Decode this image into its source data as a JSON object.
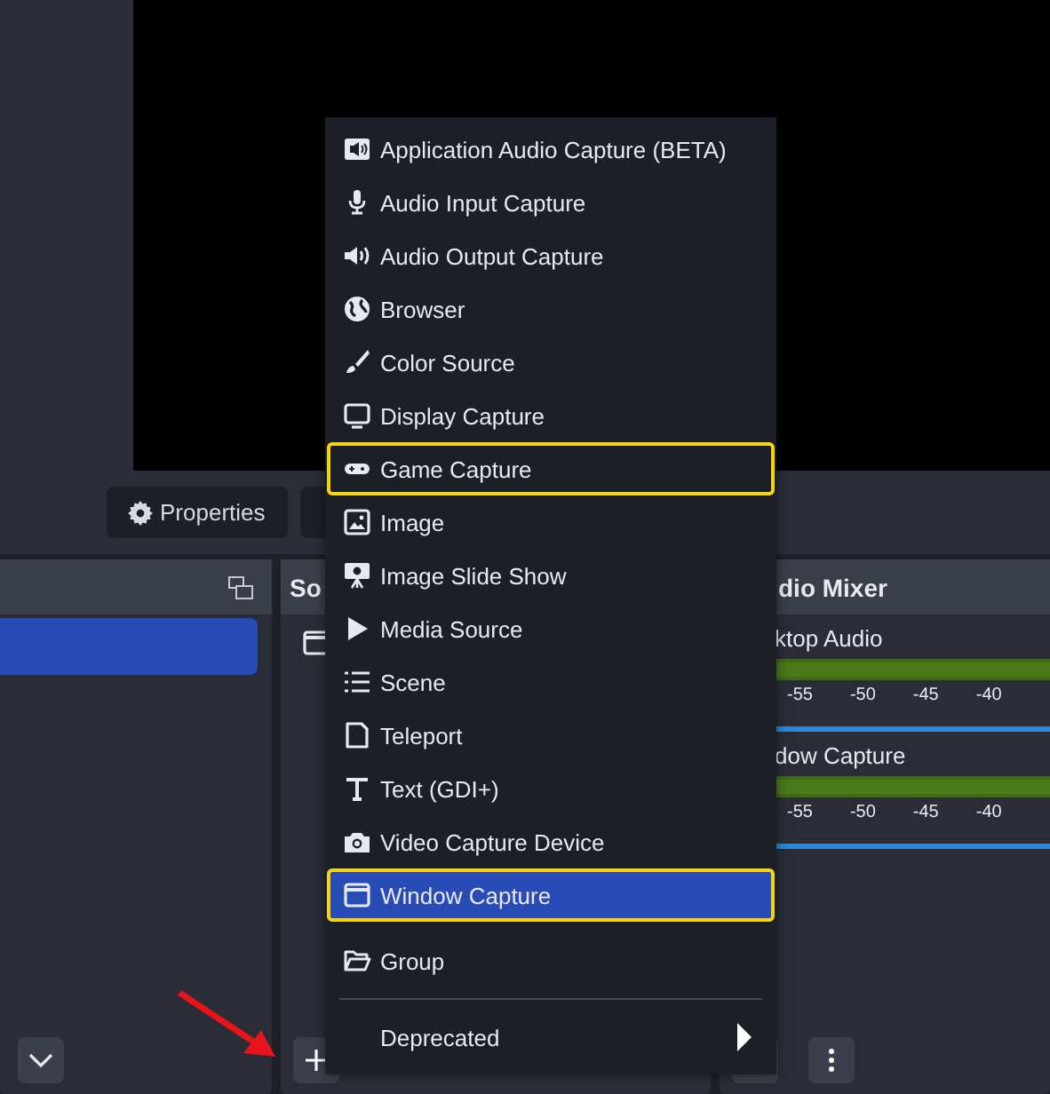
{
  "toolbar": {
    "buttons": [
      {
        "label": "Properties"
      }
    ]
  },
  "scenes_panel": {
    "rows": [
      {
        "selected": true
      }
    ]
  },
  "sources_panel": {
    "title": "So"
  },
  "audio_mixer": {
    "title": "dio Mixer",
    "channels": [
      {
        "name": "ktop Audio",
        "ticks": [
          "-55",
          "-50",
          "-45",
          "-40"
        ],
        "level": 1
      },
      {
        "name": "dow Capture",
        "ticks": [
          "-55",
          "-50",
          "-45",
          "-40"
        ],
        "level": 1
      }
    ]
  },
  "context_menu": {
    "items": [
      {
        "kind": "item",
        "label": "Application Audio Capture (BETA)",
        "selected": false,
        "highlighted": false
      },
      {
        "kind": "item",
        "label": "Audio Input Capture",
        "selected": false,
        "highlighted": false
      },
      {
        "kind": "item",
        "label": "Audio Output Capture",
        "selected": false,
        "highlighted": false
      },
      {
        "kind": "item",
        "label": "Browser",
        "selected": false,
        "highlighted": false
      },
      {
        "kind": "item",
        "label": "Color Source",
        "selected": false,
        "highlighted": false
      },
      {
        "kind": "item",
        "label": "Display Capture",
        "selected": false,
        "highlighted": false
      },
      {
        "kind": "item",
        "label": "Game Capture",
        "selected": false,
        "highlighted": true
      },
      {
        "kind": "item",
        "label": "Image",
        "selected": false,
        "highlighted": false
      },
      {
        "kind": "item",
        "label": "Image Slide Show",
        "selected": false,
        "highlighted": false
      },
      {
        "kind": "item",
        "label": "Media Source",
        "selected": false,
        "highlighted": false
      },
      {
        "kind": "item",
        "label": "Scene",
        "selected": false,
        "highlighted": false
      },
      {
        "kind": "item",
        "label": "Teleport",
        "selected": false,
        "highlighted": false
      },
      {
        "kind": "item",
        "label": "Text (GDI+)",
        "selected": false,
        "highlighted": false
      },
      {
        "kind": "item",
        "label": "Video Capture Device",
        "selected": false,
        "highlighted": false
      },
      {
        "kind": "item",
        "label": "Window Capture",
        "selected": true,
        "highlighted": true
      },
      {
        "kind": "item",
        "label": "Group",
        "selected": false,
        "highlighted": false
      },
      {
        "kind": "separator"
      },
      {
        "kind": "submenu",
        "label": "Deprecated",
        "selected": false,
        "highlighted": false
      }
    ]
  }
}
